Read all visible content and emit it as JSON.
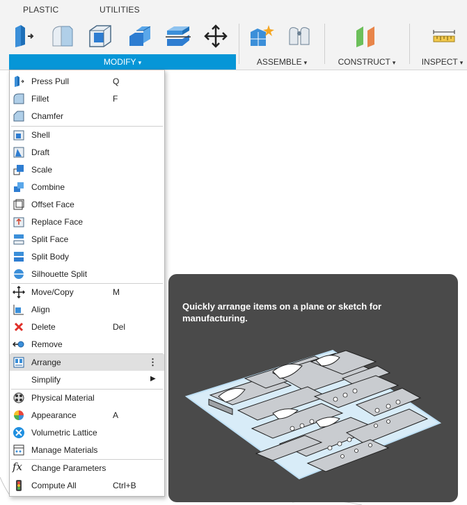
{
  "tabs": [
    "PLASTIC",
    "UTILITIES"
  ],
  "toolbar": {
    "groups": [
      {
        "label": "MODIFY",
        "caret": "▾"
      },
      {
        "label": "ASSEMBLE",
        "caret": "▾"
      },
      {
        "label": "CONSTRUCT",
        "caret": "▾"
      },
      {
        "label": "INSPECT",
        "caret": "▾"
      }
    ],
    "icons": [
      "press-pull-icon",
      "fillet-icon",
      "shell-icon",
      "combine-icon",
      "split-body-icon",
      "move-icon",
      "new-component-icon",
      "joint-icon",
      "offset-plane-icon",
      "measure-icon"
    ]
  },
  "menu": {
    "items": [
      {
        "label": "Press Pull",
        "shortcut": "Q",
        "icon": "press-pull-icon"
      },
      {
        "label": "Fillet",
        "shortcut": "F",
        "icon": "fillet-icon"
      },
      {
        "label": "Chamfer",
        "shortcut": "",
        "icon": "chamfer-icon"
      },
      {
        "label": "Shell",
        "shortcut": "",
        "icon": "shell-icon"
      },
      {
        "label": "Draft",
        "shortcut": "",
        "icon": "draft-icon"
      },
      {
        "label": "Scale",
        "shortcut": "",
        "icon": "scale-icon"
      },
      {
        "label": "Combine",
        "shortcut": "",
        "icon": "combine-icon"
      },
      {
        "label": "Offset Face",
        "shortcut": "",
        "icon": "offset-face-icon"
      },
      {
        "label": "Replace Face",
        "shortcut": "",
        "icon": "replace-face-icon"
      },
      {
        "label": "Split Face",
        "shortcut": "",
        "icon": "split-face-icon"
      },
      {
        "label": "Split Body",
        "shortcut": "",
        "icon": "split-body-icon"
      },
      {
        "label": "Silhouette Split",
        "shortcut": "",
        "icon": "silhouette-split-icon"
      },
      {
        "label": "Move/Copy",
        "shortcut": "M",
        "icon": "move-icon"
      },
      {
        "label": "Align",
        "shortcut": "",
        "icon": "align-icon"
      },
      {
        "label": "Delete",
        "shortcut": "Del",
        "icon": "delete-icon"
      },
      {
        "label": "Remove",
        "shortcut": "",
        "icon": "remove-icon"
      },
      {
        "label": "Arrange",
        "shortcut": "",
        "icon": "arrange-icon",
        "more": "⋮"
      },
      {
        "label": "Simplify",
        "shortcut": "",
        "icon": "",
        "submenu": "▶"
      },
      {
        "label": "Physical Material",
        "shortcut": "",
        "icon": "physical-material-icon"
      },
      {
        "label": "Appearance",
        "shortcut": "A",
        "icon": "appearance-icon"
      },
      {
        "label": "Volumetric Lattice",
        "shortcut": "",
        "icon": "volumetric-lattice-icon"
      },
      {
        "label": "Manage Materials",
        "shortcut": "",
        "icon": "manage-materials-icon"
      },
      {
        "label": "Change Parameters",
        "shortcut": "",
        "icon": "fx-icon"
      },
      {
        "label": "Compute All",
        "shortcut": "Ctrl+B",
        "icon": "compute-all-icon"
      }
    ],
    "highlighted": "Arrange"
  },
  "tooltip": {
    "text": "Quickly arrange items on a plane or sketch for manufacturing."
  },
  "colors": {
    "accent": "#0696d7",
    "tooltip_bg": "#4a4a4a",
    "menu_highlight": "#e0e0e0"
  }
}
